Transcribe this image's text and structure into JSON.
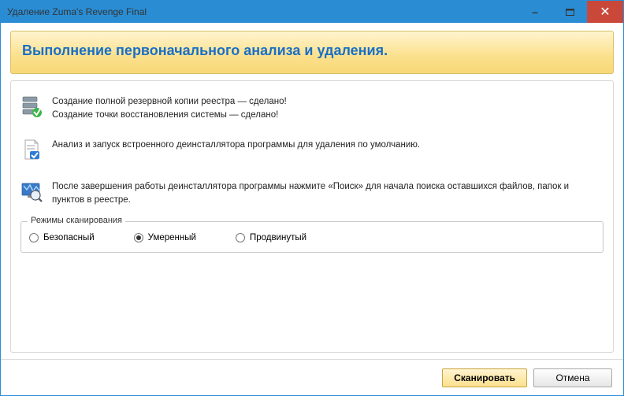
{
  "window": {
    "title": "Удаление Zuma's Revenge Final"
  },
  "header": {
    "title": "Выполнение первоначального анализа и удаления."
  },
  "steps": {
    "backup_line1": "Создание полной резервной копии реестра — сделано!",
    "backup_line2": "Создание точки восстановления системы — сделано!",
    "uninstaller": "Анализ и запуск встроенного деинсталлятора программы для удаления по умолчанию.",
    "after": "После завершения работы деинсталлятора программы нажмите «Поиск» для начала поиска оставшихся файлов, папок и пунктов в реестре."
  },
  "scan_modes": {
    "legend": "Режимы сканирования",
    "safe": "Безопасный",
    "moderate": "Умеренный",
    "advanced": "Продвинутый",
    "selected": "moderate"
  },
  "footer": {
    "scan": "Сканировать",
    "cancel": "Отмена"
  }
}
